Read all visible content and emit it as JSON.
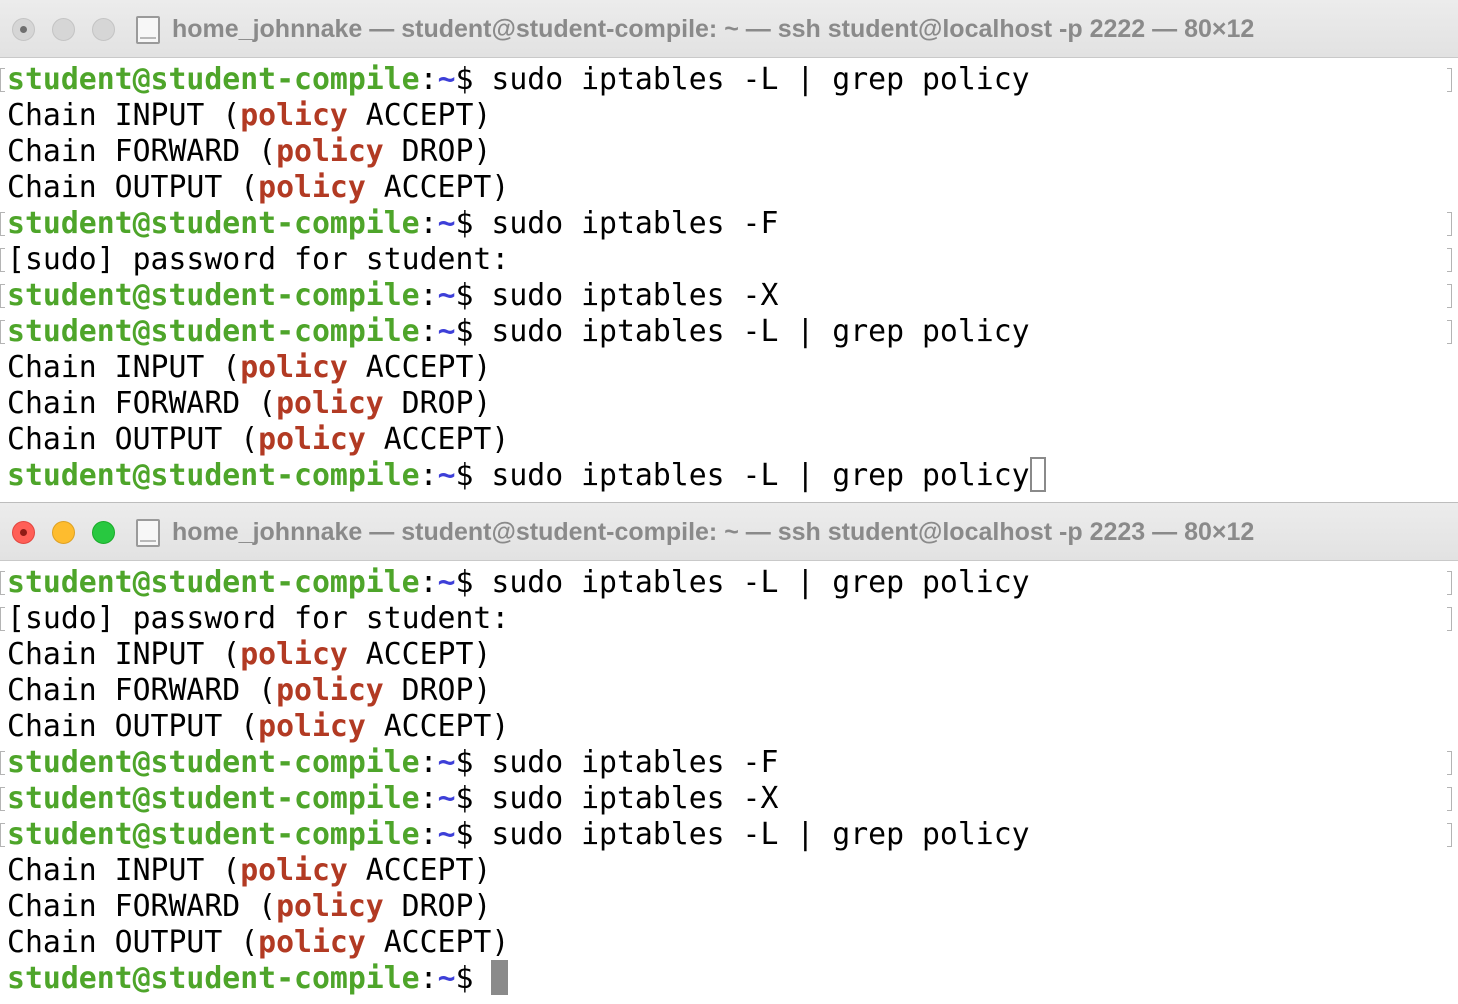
{
  "windows": [
    {
      "title": "home_johnnake — student@student-compile: ~ — ssh student@localhost -p 2222 — 80×12",
      "active": false,
      "lines": [
        {
          "kind": "prompt",
          "user": "student@student-compile",
          "colon": ":",
          "path": "~",
          "sym": "$ ",
          "cmd": "sudo iptables -L | grep policy",
          "marked": true
        },
        {
          "kind": "chain",
          "a": "Chain INPUT (",
          "hl": "policy",
          "b": " ACCEPT)",
          "marked": false
        },
        {
          "kind": "chain",
          "a": "Chain FORWARD (",
          "hl": "policy",
          "b": " DROP)",
          "marked": false
        },
        {
          "kind": "chain",
          "a": "Chain OUTPUT (",
          "hl": "policy",
          "b": " ACCEPT)",
          "marked": false
        },
        {
          "kind": "prompt",
          "user": "student@student-compile",
          "colon": ":",
          "path": "~",
          "sym": "$ ",
          "cmd": "sudo iptables -F",
          "marked": true
        },
        {
          "kind": "text",
          "text": "[sudo] password for student:",
          "marked": true
        },
        {
          "kind": "prompt",
          "user": "student@student-compile",
          "colon": ":",
          "path": "~",
          "sym": "$ ",
          "cmd": "sudo iptables -X",
          "marked": true
        },
        {
          "kind": "prompt",
          "user": "student@student-compile",
          "colon": ":",
          "path": "~",
          "sym": "$ ",
          "cmd": "sudo iptables -L | grep policy",
          "marked": true
        },
        {
          "kind": "chain",
          "a": "Chain INPUT (",
          "hl": "policy",
          "b": " ACCEPT)",
          "marked": false
        },
        {
          "kind": "chain",
          "a": "Chain FORWARD (",
          "hl": "policy",
          "b": " DROP)",
          "marked": false
        },
        {
          "kind": "chain",
          "a": "Chain OUTPUT (",
          "hl": "policy",
          "b": " ACCEPT)",
          "marked": false
        },
        {
          "kind": "prompt",
          "user": "student@student-compile",
          "colon": ":",
          "path": "~",
          "sym": "$ ",
          "cmd": "sudo iptables -L | grep policy",
          "marked": false,
          "cursor": "hollow"
        }
      ]
    },
    {
      "title": "home_johnnake — student@student-compile: ~ — ssh student@localhost -p 2223 — 80×12",
      "active": true,
      "lines": [
        {
          "kind": "prompt",
          "user": "student@student-compile",
          "colon": ":",
          "path": "~",
          "sym": "$ ",
          "cmd": "sudo iptables -L | grep policy",
          "marked": true
        },
        {
          "kind": "text",
          "text": "[sudo] password for student:",
          "marked": true
        },
        {
          "kind": "chain",
          "a": "Chain INPUT (",
          "hl": "policy",
          "b": " ACCEPT)",
          "marked": false
        },
        {
          "kind": "chain",
          "a": "Chain FORWARD (",
          "hl": "policy",
          "b": " DROP)",
          "marked": false
        },
        {
          "kind": "chain",
          "a": "Chain OUTPUT (",
          "hl": "policy",
          "b": " ACCEPT)",
          "marked": false
        },
        {
          "kind": "prompt",
          "user": "student@student-compile",
          "colon": ":",
          "path": "~",
          "sym": "$ ",
          "cmd": "sudo iptables -F",
          "marked": true
        },
        {
          "kind": "prompt",
          "user": "student@student-compile",
          "colon": ":",
          "path": "~",
          "sym": "$ ",
          "cmd": "sudo iptables -X",
          "marked": true
        },
        {
          "kind": "prompt",
          "user": "student@student-compile",
          "colon": ":",
          "path": "~",
          "sym": "$ ",
          "cmd": "sudo iptables -L | grep policy",
          "marked": true
        },
        {
          "kind": "chain",
          "a": "Chain INPUT (",
          "hl": "policy",
          "b": " ACCEPT)",
          "marked": false
        },
        {
          "kind": "chain",
          "a": "Chain FORWARD (",
          "hl": "policy",
          "b": " DROP)",
          "marked": false
        },
        {
          "kind": "chain",
          "a": "Chain OUTPUT (",
          "hl": "policy",
          "b": " ACCEPT)",
          "marked": false
        },
        {
          "kind": "prompt",
          "user": "student@student-compile",
          "colon": ":",
          "path": "~",
          "sym": "$ ",
          "cmd": "",
          "marked": false,
          "cursor": "solid"
        }
      ]
    }
  ],
  "icons": {
    "close": "close-icon",
    "minimize": "minimize-icon",
    "zoom": "zoom-icon",
    "proxy": "document-icon"
  },
  "colors": {
    "prompt_user": "#4ea52a",
    "prompt_path": "#3d3fd8",
    "grep_highlight": "#b23a23",
    "close_active": "#ff5f57",
    "minimize_active": "#febc2e",
    "zoom_active": "#28c840"
  }
}
